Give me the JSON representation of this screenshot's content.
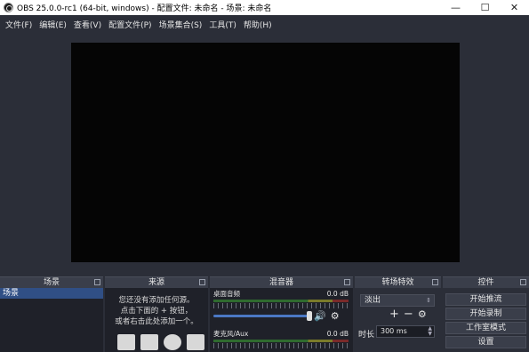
{
  "window": {
    "title": "OBS 25.0.0-rc1 (64-bit, windows) - 配置文件: 未命名 - 场景: 未命名",
    "minimize": "—",
    "maximize": "☐",
    "close": "✕"
  },
  "menu": [
    "文件(F)",
    "编辑(E)",
    "查看(V)",
    "配置文件(P)",
    "场景集合(S)",
    "工具(T)",
    "帮助(H)"
  ],
  "docks": {
    "scenes": {
      "title": "场景",
      "items": [
        "场景"
      ]
    },
    "sources": {
      "title": "来源",
      "empty_line1": "您还没有添加任何源。",
      "empty_line2": "点击下面的 + 按钮，",
      "empty_line3": "或者右击此处添加一个。",
      "icons": [
        "image-icon",
        "display-icon",
        "globe-icon",
        "camera-icon"
      ]
    },
    "mixer": {
      "title": "混音器",
      "channels": [
        {
          "name": "桌面音频",
          "level": "0.0 dB",
          "volume_fraction": 1.0
        },
        {
          "name": "麦克风/Aux",
          "level": "0.0 dB"
        }
      ]
    },
    "transitions": {
      "title": "转场特效",
      "selected": "淡出",
      "duration_label": "时长",
      "duration_value": "300 ms"
    },
    "controls": {
      "title": "控件",
      "buttons": [
        "开始推流",
        "开始录制",
        "工作室模式",
        "设置"
      ]
    }
  },
  "colors": {
    "background": "#2b2e38",
    "dock_body": "#1f2129",
    "selection": "#304f85",
    "volume_slider": "#4b78c4"
  }
}
